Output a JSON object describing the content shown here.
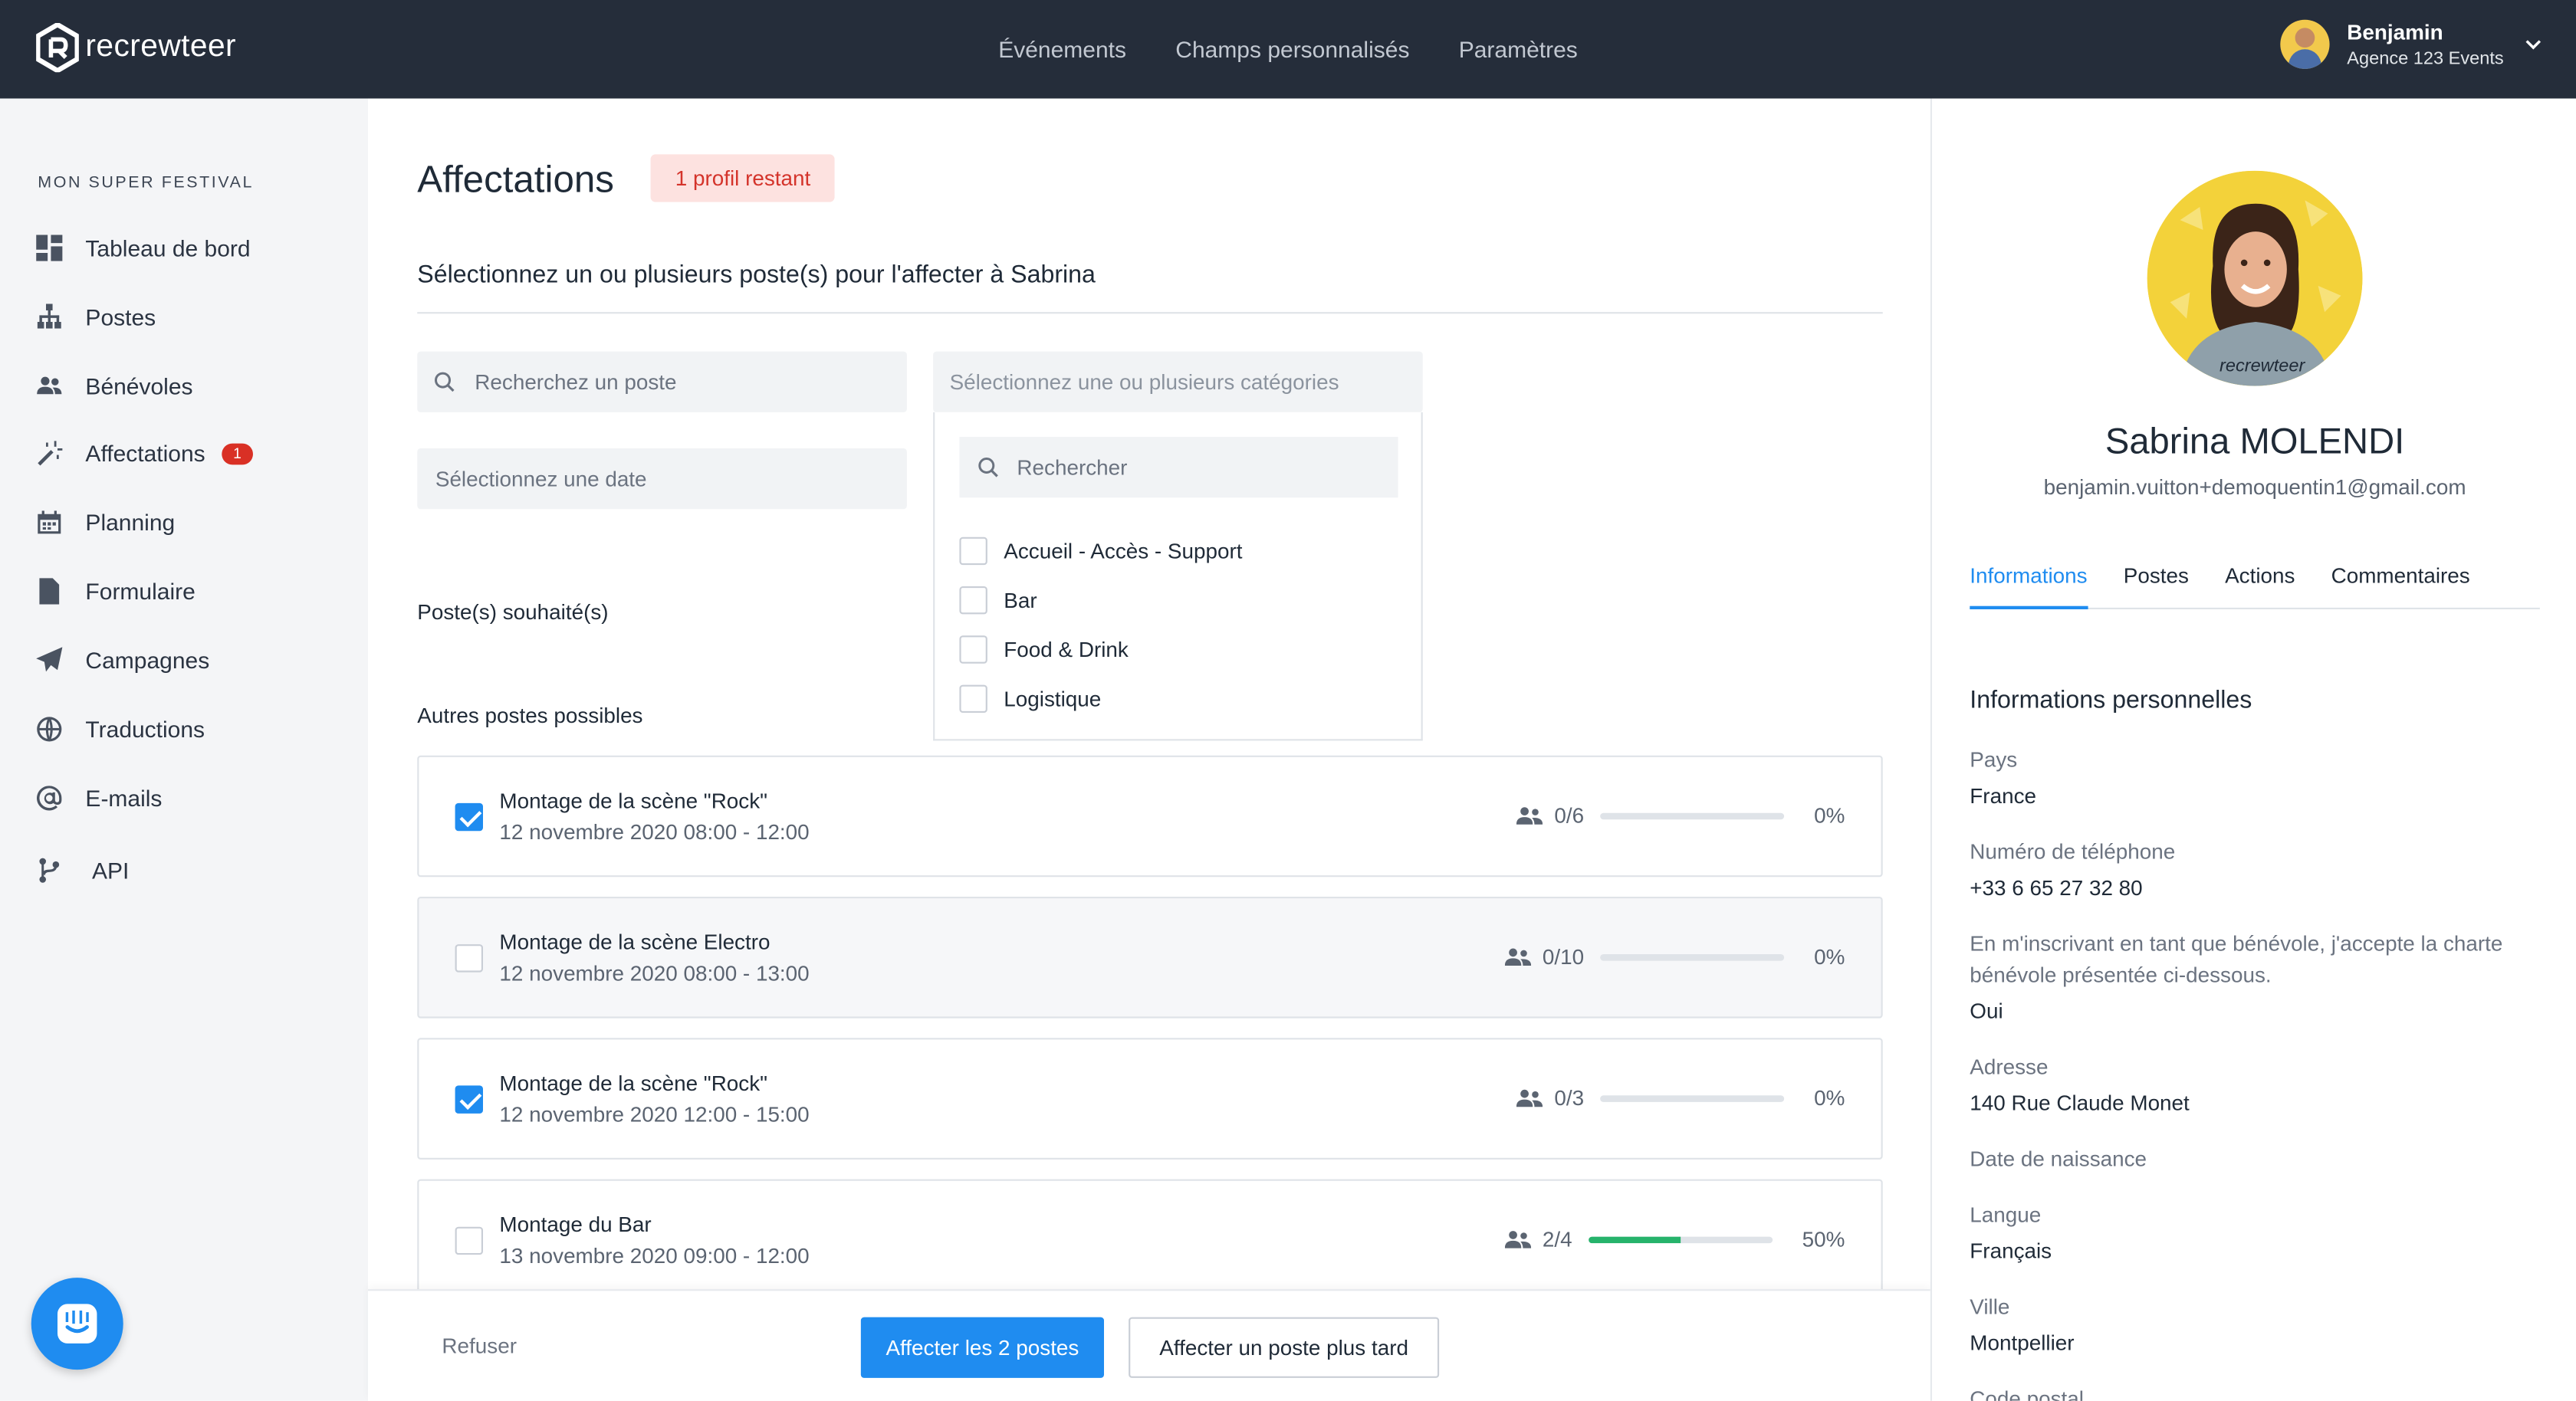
{
  "app": {
    "name": "recrewteer"
  },
  "nav": [
    "Événements",
    "Champs personnalisés",
    "Paramètres"
  ],
  "user": {
    "name": "Benjamin",
    "org": "Agence 123 Events"
  },
  "sidebar": {
    "title": "MON SUPER FESTIVAL",
    "items": [
      {
        "label": "Tableau de bord",
        "icon": "dashboard-icon"
      },
      {
        "label": "Postes",
        "icon": "org-chart-icon"
      },
      {
        "label": "Bénévoles",
        "icon": "users-icon"
      },
      {
        "label": "Affectations",
        "icon": "magic-wand-icon",
        "badge": "1"
      },
      {
        "label": "Planning",
        "icon": "calendar-icon"
      },
      {
        "label": "Formulaire",
        "icon": "file-icon"
      },
      {
        "label": "Campagnes",
        "icon": "paper-plane-icon"
      },
      {
        "label": "Traductions",
        "icon": "globe-icon"
      },
      {
        "label": "E-mails",
        "icon": "at-sign-icon"
      },
      {
        "label": "API",
        "icon": "git-branch-icon"
      }
    ]
  },
  "main": {
    "title": "Affectations",
    "remaining_badge": "1 profil restant",
    "subtitle": "Sélectionnez un ou plusieurs poste(s) pour l'affecter à Sabrina",
    "search_placeholder": "Recherchez un poste",
    "date_placeholder": "Sélectionnez une date",
    "category_placeholder": "Sélectionnez une ou plusieurs catégories",
    "dropdown": {
      "search_placeholder": "Rechercher",
      "options": [
        "Accueil - Accès - Support",
        "Bar",
        "Food & Drink",
        "Logistique"
      ]
    },
    "wished_label": "Poste(s) souhaité(s)",
    "others_label": "Autres postes possibles",
    "postes": [
      {
        "title": "Montage de la scène \"Rock\"",
        "time": "12 novembre 2020 08:00 - 12:00",
        "count": "0/6",
        "percent": "0%",
        "fill": 0,
        "checked": true
      },
      {
        "title": "Montage de la scène Electro",
        "time": "12 novembre 2020 08:00 - 13:00",
        "count": "0/10",
        "percent": "0%",
        "fill": 0,
        "checked": false
      },
      {
        "title": "Montage de la scène \"Rock\"",
        "time": "12 novembre 2020 12:00 - 15:00",
        "count": "0/3",
        "percent": "0%",
        "fill": 0,
        "checked": true
      },
      {
        "title": "Montage du Bar",
        "time": "13 novembre 2020 09:00 - 12:00",
        "count": "2/4",
        "percent": "50%",
        "fill": 0.5,
        "checked": false
      }
    ]
  },
  "footer": {
    "refuse": "Refuser",
    "assign": "Affecter les 2 postes",
    "later": "Affecter un poste plus tard"
  },
  "profile": {
    "name": "Sabrina MOLENDI",
    "email": "benjamin.vuitton+demoquentin1@gmail.com",
    "avatar_text": "recrewteer",
    "tabs": [
      "Informations",
      "Postes",
      "Actions",
      "Commentaires"
    ],
    "section_title": "Informations personnelles",
    "fields": [
      {
        "label": "Pays",
        "value": "France"
      },
      {
        "label": "Numéro de téléphone",
        "value": "+33 6 65 27 32 80"
      },
      {
        "label": "En m'inscrivant en tant que bénévole, j'accepte la charte bénévole présentée ci-dessous.",
        "value": "Oui"
      },
      {
        "label": "Adresse",
        "value": "140 Rue Claude Monet"
      },
      {
        "label": "Date de naissance",
        "value": ""
      },
      {
        "label": "Langue",
        "value": "Français"
      },
      {
        "label": "Ville",
        "value": "Montpellier"
      },
      {
        "label": "Code postal",
        "value": ""
      }
    ]
  },
  "colors": {
    "accent": "#1f8cf0",
    "topbar": "#252d3a",
    "danger": "#d93025",
    "success": "#26b36b"
  }
}
